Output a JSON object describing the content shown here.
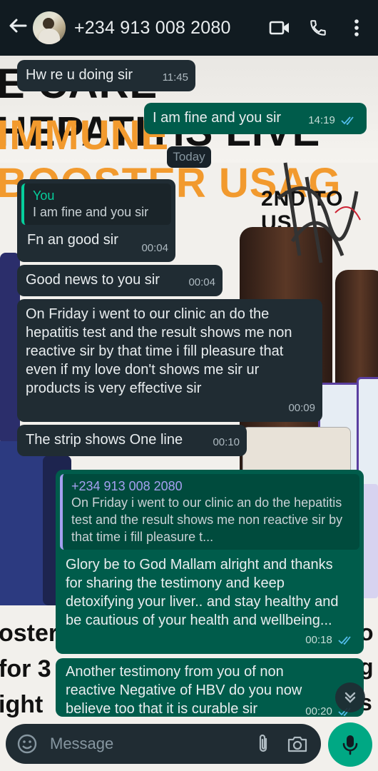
{
  "header": {
    "contact_name": "+234 913 008 2080"
  },
  "date_separator": "Today",
  "messages": [
    {
      "type": "in",
      "text": "Hw re u doing sir",
      "time": "11:45"
    },
    {
      "type": "out",
      "text": "I am fine and you sir",
      "time": "14:19",
      "status": "read"
    },
    {
      "type": "in",
      "quote_name": "You",
      "quote_text": "I am fine and you sir",
      "text": "Fn an good sir",
      "time": "00:04"
    },
    {
      "type": "in",
      "text": "Good news to you sir",
      "time": "00:04"
    },
    {
      "type": "in",
      "text": "On Friday i went to our clinic an do the hepatitis test and the result shows me non reactive sir by that time i fill pleasure that even if my love don't shows me sir ur products is very effective sir",
      "time": "00:09"
    },
    {
      "type": "in",
      "text": "The strip shows One line",
      "time": "00:10"
    },
    {
      "type": "out",
      "quote_name": "+234 913 008 2080",
      "quote_text": "On Friday i went to our clinic an do the hepatitis test and the result shows me non reactive sir by that time i fill pleasure t...",
      "text": "Glory be to God  Mallam alright and thanks for sharing the testimony and keep detoxifying your liver.. and stay healthy and be cautious of your health and wellbeing...",
      "time": "00:18",
      "status": "read"
    },
    {
      "type": "out",
      "text": "Another testimony from you of non reactive Negative of HBV do you now believe too that it is curable sir",
      "time": "00:20",
      "status": "read"
    }
  ],
  "composer": {
    "placeholder": "Message"
  },
  "wallpaper": {
    "line1": "E CARE HEPATITIS LIVE",
    "line2": "IMMUNE BOOSTER USAG",
    "side_label": "2ND TO US",
    "left_word_1": "oster",
    "left_word_2": "for 3",
    "left_word_3": "ight"
  },
  "colors": {
    "header_bg": "#111b21",
    "incoming_bubble": "#202c33",
    "outgoing_bubble": "#005c4b",
    "accent": "#00a884",
    "read_tick": "#53bdeb"
  },
  "icons": [
    "back-arrow-icon",
    "video-call-icon",
    "phone-icon",
    "more-vert-icon",
    "emoji-icon",
    "attach-icon",
    "camera-icon",
    "mic-icon",
    "chevron-double-down-icon",
    "read-tick-icon"
  ]
}
